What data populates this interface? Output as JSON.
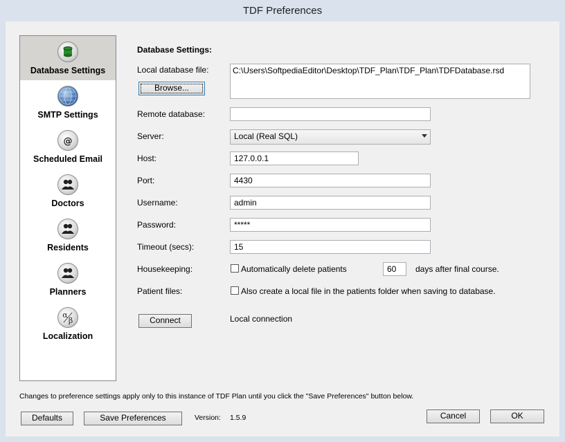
{
  "window": {
    "title": "TDF Preferences"
  },
  "sidebar": {
    "items": [
      {
        "label": "Database Settings"
      },
      {
        "label": "SMTP Settings"
      },
      {
        "label": "Scheduled Email"
      },
      {
        "label": "Doctors"
      },
      {
        "label": "Residents"
      },
      {
        "label": "Planners"
      },
      {
        "label": "Localization"
      }
    ]
  },
  "form": {
    "section_title": "Database Settings:",
    "local_db_label": "Local database file:",
    "local_db_value": "C:\\Users\\SoftpediaEditor\\Desktop\\TDF_Plan\\TDF_Plan\\TDFDatabase.rsd",
    "browse_button": "Browse...",
    "remote_db_label": "Remote database:",
    "remote_db_value": "",
    "server_label": "Server:",
    "server_value": "Local (Real SQL)",
    "host_label": "Host:",
    "host_value": "127.0.0.1",
    "port_label": "Port:",
    "port_value": "4430",
    "username_label": "Username:",
    "username_value": "admin",
    "password_label": "Password:",
    "password_value": "*****",
    "timeout_label": "Timeout (secs):",
    "timeout_value": "15",
    "housekeeping_label": "Housekeeping:",
    "housekeeping_checkbox": "Automatically delete patients",
    "housekeeping_days": "60",
    "housekeeping_suffix": "days after final course.",
    "patient_files_label": "Patient files:",
    "patient_files_checkbox": "Also create a local file in the patients folder when saving to database.",
    "connect_button": "Connect",
    "connection_status": "Local connection"
  },
  "footer": {
    "note": "Changes to preference settings apply only to this instance of TDF Plan until you click the \"Save Preferences\" button below.",
    "defaults_button": "Defaults",
    "save_button": "Save Preferences",
    "version_label": "Version:",
    "version_value": "1.5.9",
    "cancel_button": "Cancel",
    "ok_button": "OK"
  }
}
